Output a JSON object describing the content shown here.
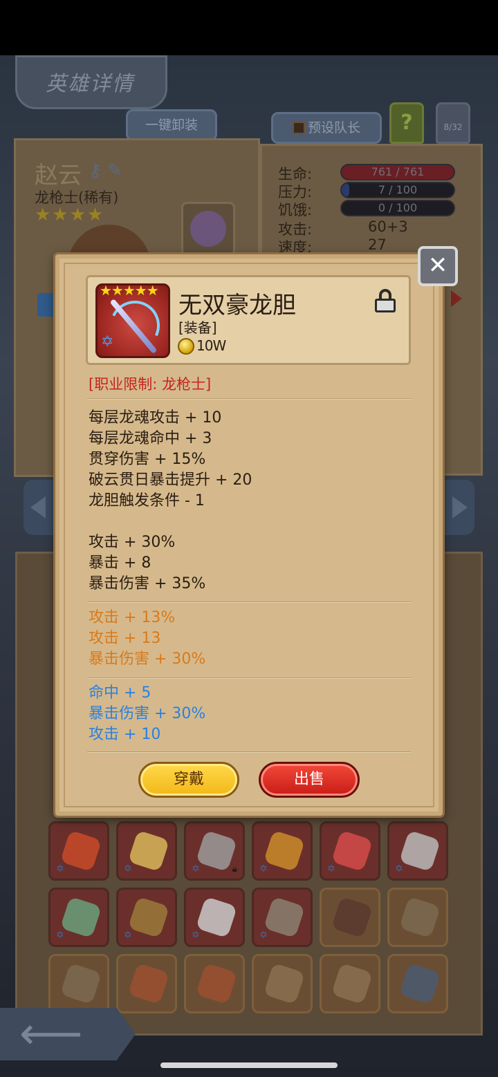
{
  "screen": {
    "title": "英雄详情",
    "unequip_all": "一键卸装",
    "preset_captain": "预设队长",
    "help": "?",
    "counter": "8/32"
  },
  "hero": {
    "name": "赵云",
    "class": "龙枪士(稀有)",
    "stars": "★★★★"
  },
  "stats": {
    "hp_label": "生命:",
    "hp_value": "761 / 761",
    "hp_fraction": 1.0,
    "stress_label": "压力:",
    "stress_value": "7 / 100",
    "stress_fraction": 0.07,
    "hunger_label": "饥饿:",
    "hunger_value": "0 / 100",
    "hunger_fraction": 0.0,
    "attack_label": "攻击:",
    "attack_value": "60+3",
    "speed_label": "速度:",
    "speed_value": "27"
  },
  "item_popup": {
    "name": "无双豪龙胆",
    "type": "[装备]",
    "price": "10W",
    "stars": "★★★★★",
    "restriction": "[职业限制: 龙枪士]",
    "base_stats": [
      "每层龙魂攻击 + 10",
      "每层龙魂命中 + 3",
      "贯穿伤害 + 15%",
      "破云贯日暴击提升 + 20",
      "龙胆触发条件 - 1",
      "",
      "攻击 + 30%",
      "暴击 + 8",
      "暴击伤害 + 35%"
    ],
    "orange_stats": [
      "攻击 + 13%",
      "攻击 + 13",
      "暴击伤害 + 30%"
    ],
    "blue_stats": [
      "命中 + 5",
      "暴击伤害 + 30%",
      "攻击 + 10"
    ],
    "equip_label": "穿戴",
    "sell_label": "出售"
  },
  "colors": {
    "restriction": "#c6231e",
    "orange_stat": "#d87a1c",
    "blue_stat": "#2a80df",
    "equip_button": "#f3b718",
    "sell_button": "#c81c16"
  },
  "inventory": {
    "row1": [
      {
        "icon": "heart-armor-icon",
        "tint": "#c84a2a"
      },
      {
        "icon": "winged-helmet-icon",
        "tint": "#d7b65a"
      },
      {
        "icon": "battle-axe-icon",
        "tint": "#9a9a9a",
        "locked": true
      },
      {
        "icon": "jewel-ring-icon",
        "tint": "#c98b2a"
      },
      {
        "icon": "ruby-amulet-icon",
        "tint": "#d44a4a"
      },
      {
        "icon": "scythe-blade-icon",
        "tint": "#b8b8b8"
      }
    ],
    "row2": [
      {
        "icon": "jade-dagger-icon",
        "tint": "#6aa07a"
      },
      {
        "icon": "spellbook-icon",
        "tint": "#9a7a3a"
      },
      {
        "icon": "bell-charm-icon",
        "tint": "#c9c9c9"
      },
      {
        "icon": "cloak-icon",
        "tint": "#8a8070"
      },
      {
        "icon": "dark-gauntlet-icon",
        "tint": "#5a3a30",
        "gold": true
      },
      {
        "icon": "pickaxe-icon",
        "tint": "#7a6a50",
        "gold": true
      }
    ],
    "row3": [
      {
        "icon": "pickaxe-icon",
        "tint": "#7a6a50",
        "gold": true
      },
      {
        "icon": "crossed-daggers-icon",
        "tint": "#9a5030",
        "gold": true
      },
      {
        "icon": "crossed-daggers-icon",
        "tint": "#9a5030",
        "gold": true
      },
      {
        "icon": "crossbow-icon",
        "tint": "#8a7050",
        "gold": true
      },
      {
        "icon": "crossbow-icon",
        "tint": "#8a7050",
        "gold": true
      },
      {
        "icon": "dark-crossbow-icon",
        "tint": "#4a5a70",
        "gold": true
      }
    ]
  }
}
